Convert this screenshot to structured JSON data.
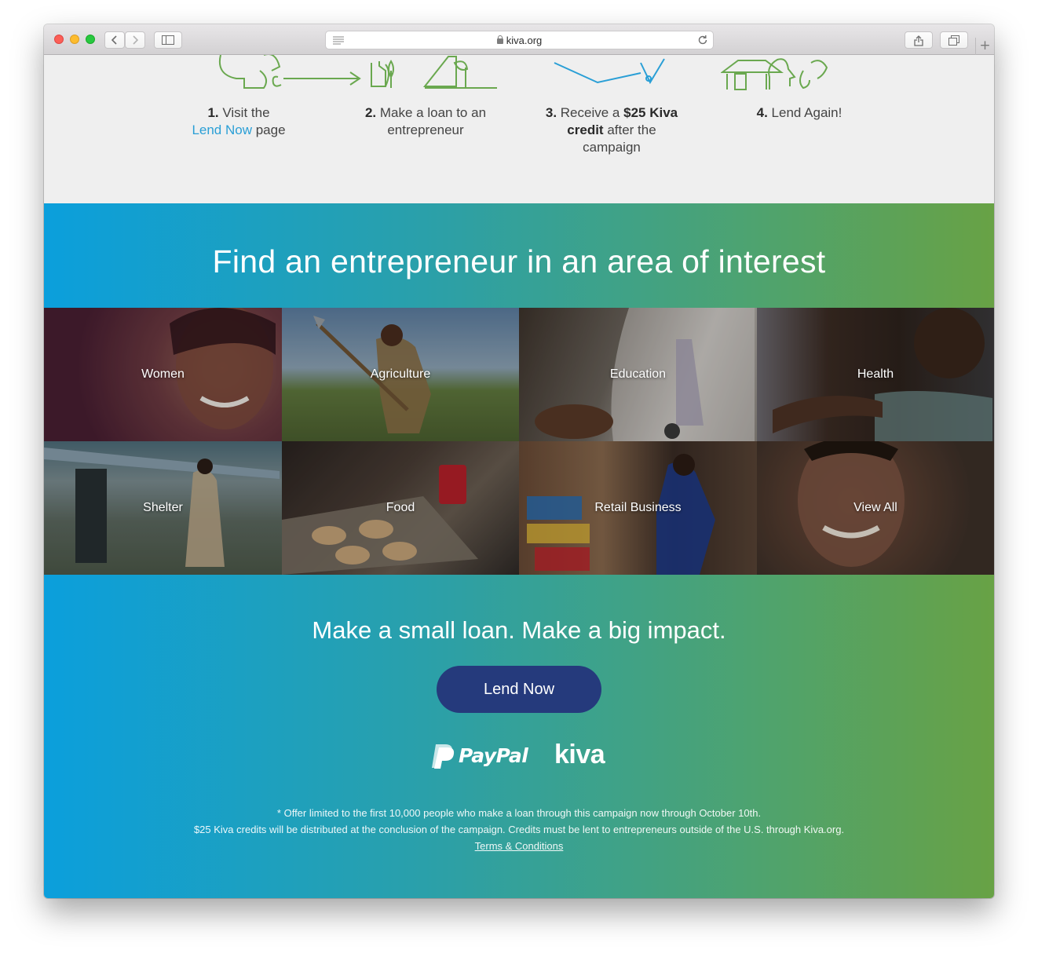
{
  "browser": {
    "url": "kiva.org"
  },
  "steps": [
    {
      "num": "1.",
      "line1": "Visit the",
      "link": "Lend Now",
      "line2_suffix": " page"
    },
    {
      "num": "2.",
      "line1": "Make a loan to an",
      "line2": "entrepreneur"
    },
    {
      "num": "3.",
      "line1": "Receive a",
      "bold1": "$25 Kiva",
      "bold2": "credit",
      "line2_suffix": " after the",
      "line3": "campaign"
    },
    {
      "num": "4.",
      "line1": "Lend Again!"
    }
  ],
  "interest": {
    "title": "Find an entrepreneur in an area of interest",
    "tiles": [
      {
        "label": "Women",
        "color": "#5e2a3a"
      },
      {
        "label": "Agriculture",
        "color": "#5a6f55"
      },
      {
        "label": "Education",
        "color": "#5b5650"
      },
      {
        "label": "Health",
        "color": "#473f36"
      },
      {
        "label": "Shelter",
        "color": "#556363"
      },
      {
        "label": "Food",
        "color": "#3d3532"
      },
      {
        "label": "Retail Business",
        "color": "#5b4436"
      },
      {
        "label": "View All",
        "color": "#4a3b30"
      }
    ]
  },
  "cta": {
    "tagline": "Make a small loan. Make a big impact.",
    "button": "Lend Now"
  },
  "partners": {
    "paypal": "PayPal",
    "kiva": "kiva"
  },
  "fineprint": {
    "line1": "* Offer limited to the first 10,000 people who make a loan through this campaign now through October 10th.",
    "line2": "$25 Kiva credits will be distributed at the conclusion of the campaign. Credits must be lent to entrepreneurs outside of the U.S. through Kiva.org.",
    "terms": "Terms & Conditions"
  },
  "colors": {
    "gradient_start": "#0b9fdc",
    "gradient_end": "#68a245",
    "button_bg": "#253a7c",
    "link": "#2a9fd6",
    "illustration_green": "#6aa84f",
    "illustration_blue": "#2a9fd6"
  }
}
